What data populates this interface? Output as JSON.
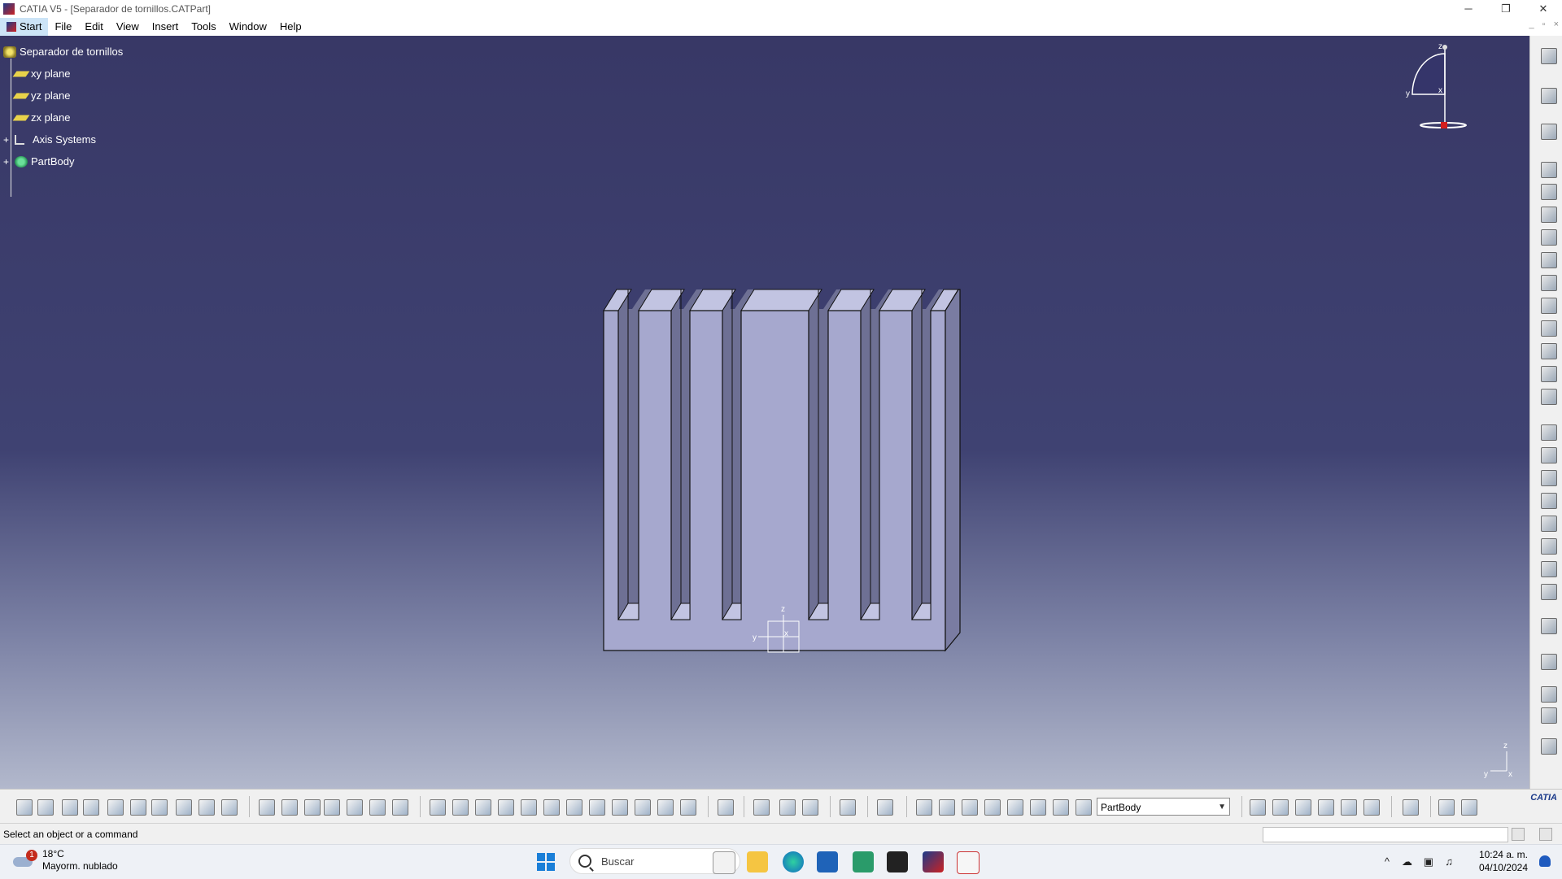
{
  "window": {
    "title": "CATIA V5 - [Separador de tornillos.CATPart]",
    "controls": [
      "─",
      "❐",
      "✕"
    ]
  },
  "menu": {
    "items": [
      "Start",
      "File",
      "Edit",
      "View",
      "Insert",
      "Tools",
      "Window",
      "Help"
    ],
    "mdi_controls": [
      "_",
      "▫",
      "×"
    ]
  },
  "tree": {
    "root": "Separador de tornillos",
    "children": [
      {
        "label": "xy plane",
        "icon": "plane-icon"
      },
      {
        "label": "yz plane",
        "icon": "plane-icon"
      },
      {
        "label": "zx plane",
        "icon": "plane-icon"
      },
      {
        "label": "Axis Systems",
        "icon": "axis-system-icon"
      },
      {
        "label": "PartBody",
        "icon": "partbody-icon"
      }
    ]
  },
  "compass": {
    "labels": [
      "z",
      "y",
      "x"
    ]
  },
  "model_axis": {
    "labels": [
      "z",
      "y",
      "x"
    ]
  },
  "corner_axis": {
    "labels": [
      "z",
      "y",
      "x"
    ]
  },
  "colors": {
    "viewport_top": "#383866",
    "viewport_bottom": "#b2b8cc",
    "part_face": "#a6a8ce",
    "part_side": "#6e7094",
    "part_top": "#c2c4e2"
  },
  "toolbar": {
    "current_body": "PartBody",
    "brand": "CATIA"
  },
  "status": {
    "message": "Select an object or a command"
  },
  "taskbar": {
    "weather_temp": "18°C",
    "weather_desc": "Mayorm. nublado",
    "weather_badge": "1",
    "search_placeholder": "Buscar",
    "time": "10:24 a. m.",
    "date": "04/10/2024"
  }
}
